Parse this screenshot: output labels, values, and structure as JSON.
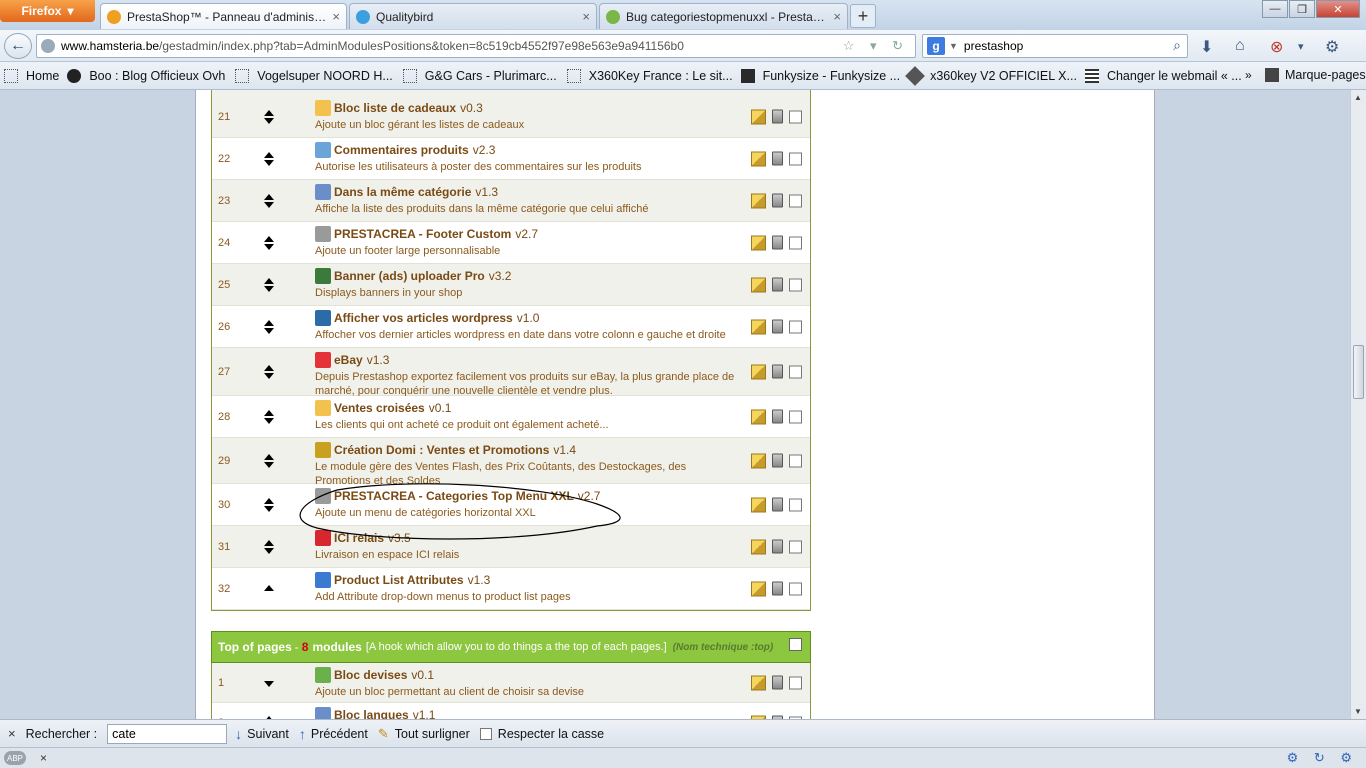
{
  "browser": {
    "firefox_button": "Firefox",
    "tabs": [
      {
        "label": "PrestaShop™ - Panneau d'administrat...",
        "close": "×",
        "favicon_color": "#f0a020"
      },
      {
        "label": "Qualitybird",
        "close": "×",
        "favicon_color": "#3ca0e0"
      },
      {
        "label": "Bug categoriestopmenuxxl - PrestaSh...",
        "close": "×",
        "favicon_color": "#7ab648"
      }
    ],
    "new_tab": "+",
    "window_controls": {
      "minimize": "—",
      "maximize": "❐",
      "close": "✕"
    },
    "back": "←",
    "url_domain": "www.hamsteria.be",
    "url_rest": "/gestadmin/index.php?tab=AdminModulesPositions&token=8c519cb4552f97e98e563e9a941156b0",
    "url_icons": "☆ ▾ ↻",
    "search_engine": "g",
    "search_value": "prestashop",
    "search_icon": "⌕",
    "download_icon": "⬇",
    "home_icon": "⌂",
    "addon_icon": "⊗",
    "menu_icon": "▾",
    "settings_icon": "⚙"
  },
  "bookmarks": {
    "items": [
      "Home",
      "Boo : Blog Officieux Ovh",
      "Vogelsuper NOORD H...",
      "G&G Cars - Plurimarc...",
      "X360Key France : Le sit...",
      "Funkysize - Funkysize ...",
      "x360key V2 OFFICIEL X...",
      "Changer le webmail « ..."
    ],
    "more": "»",
    "marque_pages": "Marque-pages"
  },
  "modules": [
    {
      "num": "21",
      "name": "Bloc liste de cadeaux",
      "version": "v0.3",
      "desc": "Ajoute un bloc gérant les listes de cadeaux",
      "icon_color": "#f2c14e"
    },
    {
      "num": "22",
      "name": "Commentaires produits",
      "version": "v2.3",
      "desc": "Autorise les utilisateurs à poster des commentaires sur les produits",
      "icon_color": "#6aa4d8"
    },
    {
      "num": "23",
      "name": "Dans la même catégorie",
      "version": "v1.3",
      "desc": "Affiche la liste des produits dans la même catégorie que celui affiché",
      "icon_color": "#6a8fc8"
    },
    {
      "num": "24",
      "name": "PRESTACREA - Footer Custom",
      "version": "v2.7",
      "desc": "Ajoute un footer large personnalisable",
      "icon_color": "#9a9a9a"
    },
    {
      "num": "25",
      "name": "Banner (ads) uploader Pro",
      "version": "v3.2",
      "desc": "Displays banners in your shop",
      "icon_color": "#3b7a3b"
    },
    {
      "num": "26",
      "name": "Afficher vos articles wordpress",
      "version": "v1.0",
      "desc": "Affocher vos dernier articles wordpress en date dans votre colonn e gauche et droite",
      "icon_color": "#2b6ca8"
    },
    {
      "num": "27",
      "name": "eBay",
      "version": "v1.3",
      "desc": "Depuis Prestashop exportez facilement vos produits sur eBay, la plus grande place de marché, pour conquérir une nouvelle clientèle et vendre plus.",
      "icon_color": "#e53238"
    },
    {
      "num": "28",
      "name": "Ventes croisées",
      "version": "v0.1",
      "desc": "Les clients qui ont acheté ce produit ont également acheté...",
      "icon_color": "#f2c14e"
    },
    {
      "num": "29",
      "name": "Création Domi : Ventes et Promotions",
      "version": "v1.4",
      "desc": "Le module gère des Ventes Flash, des Prix Coûtants, des Destockages, des Promotions et des Soldes",
      "icon_color": "#c9a020"
    },
    {
      "num": "30",
      "name": "PRESTACREA - Categories Top Menu XXL",
      "version": "v2.7",
      "desc": "Ajoute un menu de catégories horizontal XXL",
      "icon_color": "#9a9a9a"
    },
    {
      "num": "31",
      "name": "ICI relais",
      "version": "v3.5",
      "desc": "Livraison en espace ICI relais",
      "icon_color": "#d8262e"
    },
    {
      "num": "32",
      "name": "Product List Attributes",
      "version": "v1.3",
      "desc": "Add Attribute drop-down menus to product list pages",
      "icon_color": "#3a7ad0"
    }
  ],
  "section": {
    "title": "Top of pages",
    "separator": "-",
    "count": "8",
    "modules_word": "modules",
    "desc": "[A hook which allow you to do things a the top of each pages.]",
    "technical": "(Nom technique :top)"
  },
  "modules2": [
    {
      "num": "1",
      "name": "Bloc devises",
      "version": "v0.1",
      "desc": "Ajoute un bloc permettant au client de choisir sa devise",
      "icon_color": "#6ab04c"
    },
    {
      "num": "2",
      "name": "Bloc langues",
      "version": "v1.1",
      "desc": "",
      "icon_color": "#6a8fc8"
    }
  ],
  "findbar": {
    "close": "×",
    "label": "Rechercher :",
    "value": "cate",
    "next": "Suivant",
    "prev": "Précédent",
    "highlight": "Tout surligner",
    "match_case": "Respecter la casse"
  },
  "statusbar": {
    "abp": "ABP",
    "close": "×",
    "right_icons": "⚙ ↻ ⚙"
  }
}
